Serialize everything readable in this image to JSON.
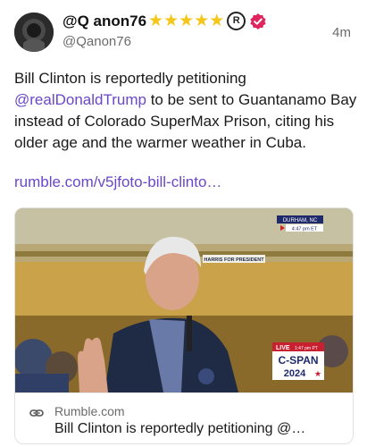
{
  "post": {
    "display_name": "@Q anon76",
    "stars": [
      "★",
      "★",
      "★",
      "★",
      "★"
    ],
    "registered_mark": "R",
    "handle": "@Qanon76",
    "timestamp": "4m",
    "text_before": "Bill Clinton is reportedly petitioning ",
    "mention": "@realDonaldTrump",
    "text_after": " to be sent to Guantanamo Bay instead of Colorado SuperMax Prison, citing his older age and the warmer weather in Cuba.",
    "link": "rumble.com/v5jfoto-bill-clinto…"
  },
  "card": {
    "domain": "Rumble.com",
    "title": "Bill Clinton is reportedly petitioning @…",
    "media_overlay": {
      "location": "DURHAM, NC",
      "time": "4:47 pm ET",
      "banner": "HARRIS FOR PRESIDENT",
      "live": "LIVE",
      "live_time": "1:47 pm PT",
      "network": "C-SPAN",
      "year": "2024"
    }
  },
  "colors": {
    "accent": "#6a47c8",
    "verified": "#e0245e",
    "star": "#f5c518"
  }
}
